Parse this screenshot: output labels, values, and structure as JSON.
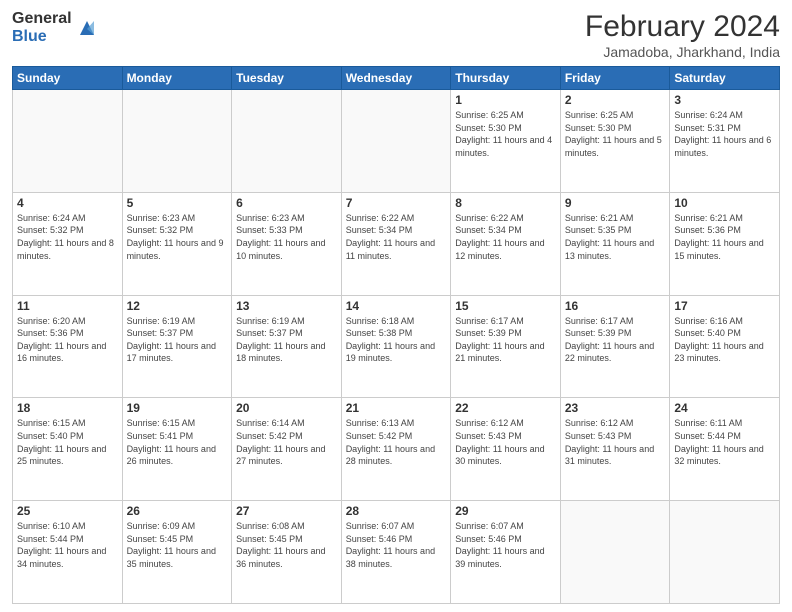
{
  "logo": {
    "general": "General",
    "blue": "Blue"
  },
  "header": {
    "month": "February 2024",
    "location": "Jamadoba, Jharkhand, India"
  },
  "days_of_week": [
    "Sunday",
    "Monday",
    "Tuesday",
    "Wednesday",
    "Thursday",
    "Friday",
    "Saturday"
  ],
  "weeks": [
    [
      {
        "day": "",
        "info": ""
      },
      {
        "day": "",
        "info": ""
      },
      {
        "day": "",
        "info": ""
      },
      {
        "day": "",
        "info": ""
      },
      {
        "day": "1",
        "info": "Sunrise: 6:25 AM\nSunset: 5:30 PM\nDaylight: 11 hours and 4 minutes."
      },
      {
        "day": "2",
        "info": "Sunrise: 6:25 AM\nSunset: 5:30 PM\nDaylight: 11 hours and 5 minutes."
      },
      {
        "day": "3",
        "info": "Sunrise: 6:24 AM\nSunset: 5:31 PM\nDaylight: 11 hours and 6 minutes."
      }
    ],
    [
      {
        "day": "4",
        "info": "Sunrise: 6:24 AM\nSunset: 5:32 PM\nDaylight: 11 hours and 8 minutes."
      },
      {
        "day": "5",
        "info": "Sunrise: 6:23 AM\nSunset: 5:32 PM\nDaylight: 11 hours and 9 minutes."
      },
      {
        "day": "6",
        "info": "Sunrise: 6:23 AM\nSunset: 5:33 PM\nDaylight: 11 hours and 10 minutes."
      },
      {
        "day": "7",
        "info": "Sunrise: 6:22 AM\nSunset: 5:34 PM\nDaylight: 11 hours and 11 minutes."
      },
      {
        "day": "8",
        "info": "Sunrise: 6:22 AM\nSunset: 5:34 PM\nDaylight: 11 hours and 12 minutes."
      },
      {
        "day": "9",
        "info": "Sunrise: 6:21 AM\nSunset: 5:35 PM\nDaylight: 11 hours and 13 minutes."
      },
      {
        "day": "10",
        "info": "Sunrise: 6:21 AM\nSunset: 5:36 PM\nDaylight: 11 hours and 15 minutes."
      }
    ],
    [
      {
        "day": "11",
        "info": "Sunrise: 6:20 AM\nSunset: 5:36 PM\nDaylight: 11 hours and 16 minutes."
      },
      {
        "day": "12",
        "info": "Sunrise: 6:19 AM\nSunset: 5:37 PM\nDaylight: 11 hours and 17 minutes."
      },
      {
        "day": "13",
        "info": "Sunrise: 6:19 AM\nSunset: 5:37 PM\nDaylight: 11 hours and 18 minutes."
      },
      {
        "day": "14",
        "info": "Sunrise: 6:18 AM\nSunset: 5:38 PM\nDaylight: 11 hours and 19 minutes."
      },
      {
        "day": "15",
        "info": "Sunrise: 6:17 AM\nSunset: 5:39 PM\nDaylight: 11 hours and 21 minutes."
      },
      {
        "day": "16",
        "info": "Sunrise: 6:17 AM\nSunset: 5:39 PM\nDaylight: 11 hours and 22 minutes."
      },
      {
        "day": "17",
        "info": "Sunrise: 6:16 AM\nSunset: 5:40 PM\nDaylight: 11 hours and 23 minutes."
      }
    ],
    [
      {
        "day": "18",
        "info": "Sunrise: 6:15 AM\nSunset: 5:40 PM\nDaylight: 11 hours and 25 minutes."
      },
      {
        "day": "19",
        "info": "Sunrise: 6:15 AM\nSunset: 5:41 PM\nDaylight: 11 hours and 26 minutes."
      },
      {
        "day": "20",
        "info": "Sunrise: 6:14 AM\nSunset: 5:42 PM\nDaylight: 11 hours and 27 minutes."
      },
      {
        "day": "21",
        "info": "Sunrise: 6:13 AM\nSunset: 5:42 PM\nDaylight: 11 hours and 28 minutes."
      },
      {
        "day": "22",
        "info": "Sunrise: 6:12 AM\nSunset: 5:43 PM\nDaylight: 11 hours and 30 minutes."
      },
      {
        "day": "23",
        "info": "Sunrise: 6:12 AM\nSunset: 5:43 PM\nDaylight: 11 hours and 31 minutes."
      },
      {
        "day": "24",
        "info": "Sunrise: 6:11 AM\nSunset: 5:44 PM\nDaylight: 11 hours and 32 minutes."
      }
    ],
    [
      {
        "day": "25",
        "info": "Sunrise: 6:10 AM\nSunset: 5:44 PM\nDaylight: 11 hours and 34 minutes."
      },
      {
        "day": "26",
        "info": "Sunrise: 6:09 AM\nSunset: 5:45 PM\nDaylight: 11 hours and 35 minutes."
      },
      {
        "day": "27",
        "info": "Sunrise: 6:08 AM\nSunset: 5:45 PM\nDaylight: 11 hours and 36 minutes."
      },
      {
        "day": "28",
        "info": "Sunrise: 6:07 AM\nSunset: 5:46 PM\nDaylight: 11 hours and 38 minutes."
      },
      {
        "day": "29",
        "info": "Sunrise: 6:07 AM\nSunset: 5:46 PM\nDaylight: 11 hours and 39 minutes."
      },
      {
        "day": "",
        "info": ""
      },
      {
        "day": "",
        "info": ""
      }
    ]
  ]
}
